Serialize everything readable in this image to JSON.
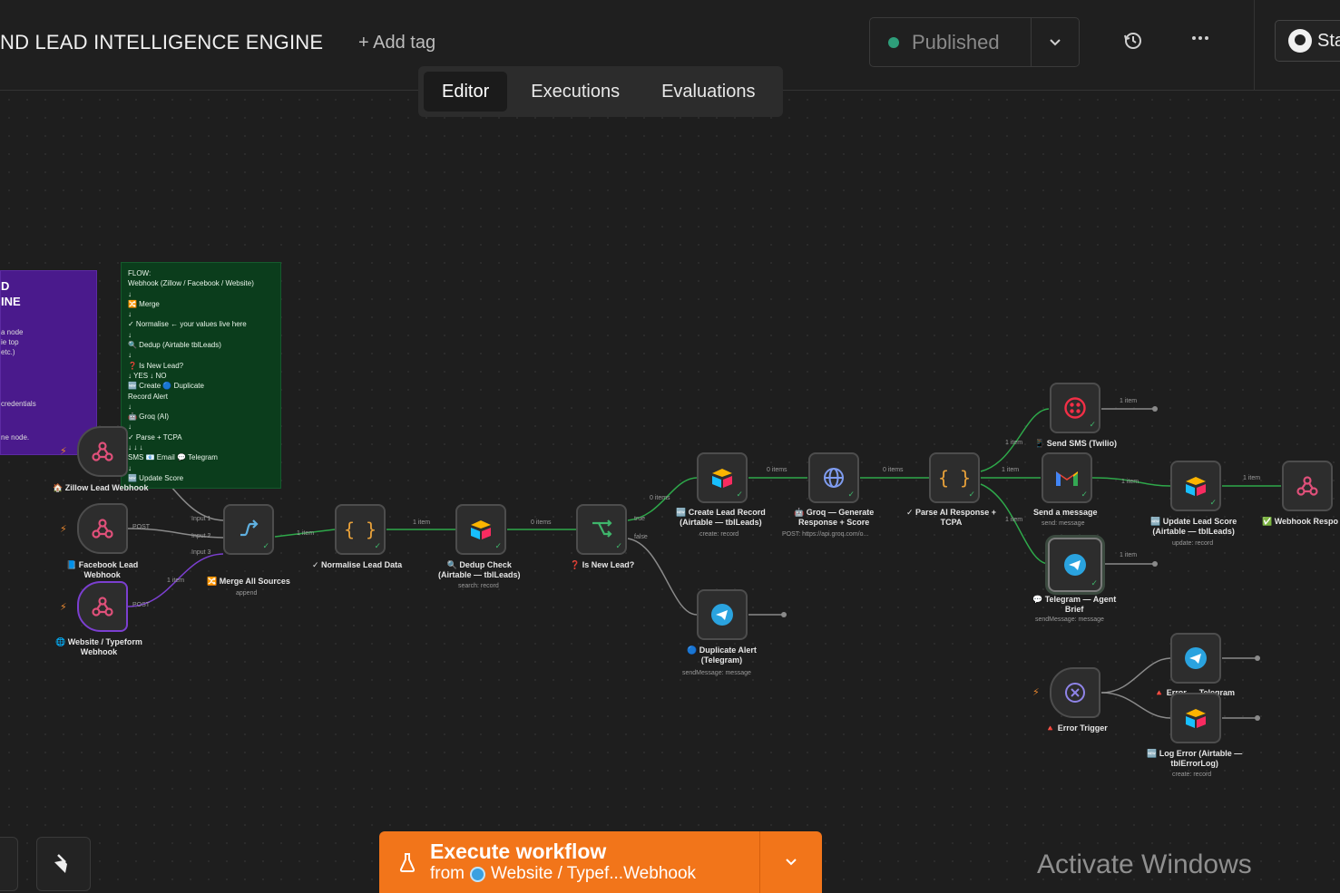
{
  "header": {
    "title": "ND LEAD INTELLIGENCE ENGINE",
    "add_tag": "+ Add tag",
    "publish_label": "Published",
    "github_label": "Sta"
  },
  "tabs": [
    {
      "label": "Editor",
      "active": true
    },
    {
      "label": "Executions",
      "active": false
    },
    {
      "label": "Evaluations",
      "active": false
    }
  ],
  "sticky_purple": {
    "lines_big": [
      "D",
      "INE"
    ],
    "lines_small": [
      "a node",
      "ie top",
      "etc.)",
      "",
      "",
      "credentials",
      "",
      "ne node."
    ]
  },
  "sticky_green": {
    "lines": [
      "FLOW:",
      "Webhook (Zillow / Facebook / Website)",
      "↓",
      "🔀 Merge",
      "↓",
      "✓ Normalise ← your values live here",
      "↓",
      "🔍 Dedup (Airtable tblLeads)",
      "↓",
      "❓ Is New Lead?",
      "↓ YES ↓ NO",
      "🆕 Create 🔵 Duplicate",
      "Record Alert",
      "↓",
      "🤖 Groq (AI)",
      "↓",
      "✓ Parse + TCPA",
      "↓ ↓ ↓",
      "SMS 📧 Email 💬 Telegram",
      "↓",
      "🆕 Update Score"
    ]
  },
  "nodes": {
    "zillow": {
      "label": "🏠 Zillow Lead Webhook"
    },
    "facebook": {
      "label1": "📘 Facebook Lead",
      "label2": "Webhook",
      "port": "POST"
    },
    "website": {
      "label1": "🌐 Website / Typeform",
      "label2": "Webhook",
      "port": "POST"
    },
    "merge": {
      "label": "🔀 Merge All Sources",
      "sub": "append",
      "in1": "Input 1",
      "in2": "Input 2",
      "in3": "Input 3"
    },
    "normalise": {
      "label": "✓ Normalise Lead Data"
    },
    "dedup": {
      "label1": "🔍 Dedup Check",
      "label2": "(Airtable — tblLeads)",
      "sub": "search: record"
    },
    "is_new": {
      "label": "❓ Is New Lead?",
      "out_true": "true",
      "out_false": "false"
    },
    "create_lead": {
      "label1": "🆕 Create Lead Record",
      "label2": "(Airtable — tblLeads)",
      "sub": "create: record"
    },
    "duplicate_alert": {
      "label1": "🔵 Duplicate Alert",
      "label2": "(Telegram)",
      "sub": "sendMessage: message"
    },
    "groq": {
      "label1": "🤖 Groq — Generate",
      "label2": "Response + Score",
      "sub": "POST: https://api.groq.com/o..."
    },
    "parse": {
      "label1": "✓ Parse AI Response +",
      "label2": "TCPA"
    },
    "send_sms": {
      "label": "📱 Send SMS (Twilio)"
    },
    "send_message": {
      "label": "Send a message",
      "sub": "send: message"
    },
    "telegram_agent": {
      "label1": "💬 Telegram — Agent",
      "label2": "Brief",
      "sub": "sendMessage: message"
    },
    "update_score": {
      "label1": "🆕 Update Lead Score",
      "label2": "(Airtable — tblLeads)",
      "sub": "update: record"
    },
    "webhook_response": {
      "label": "✅ Webhook Respo"
    },
    "error_trigger": {
      "label": "🔺 Error Trigger"
    },
    "error_telegram": {
      "label": "🔺 Error — Telegram"
    },
    "log_error": {
      "label1": "🆕 Log Error (Airtable —",
      "label2": "tblErrorLog)",
      "sub": "create: record"
    }
  },
  "connection_labels": {
    "zillow_merge": "1 item",
    "website_merge": "1 item",
    "merge_normalise": "1 item",
    "normalise_dedup": "1 item",
    "dedup_isnew": "0 items",
    "isnew_create": "0 items",
    "create_groq": "0 items",
    "groq_parse": "0 items",
    "parse_sms": "1 item",
    "parse_send": "1 item",
    "parse_telegram": "1 item",
    "sms_out": "1 item",
    "send_update": "1 item",
    "update_webhook": "1 item",
    "telegram_out": "1 item"
  },
  "footer": {
    "execute_line1": "Execute workflow",
    "execute_from": "from",
    "execute_line2": "Website / Typef...Webhook",
    "activate_windows": "Activate Windows"
  },
  "colors": {
    "accent_orange": "#f2751a",
    "published_dot": "#2e9e7a",
    "sticky_purple": "#4a1a8c",
    "sticky_green": "#0b3d1c",
    "wire": "#2ea84a",
    "webhook_icon": "#e0507a"
  },
  "icons": {
    "history": "history-icon",
    "more": "more-horizontal-icon",
    "caret": "chevron-down-icon",
    "flask": "flask-icon",
    "broom": "broom-icon",
    "github": "github-icon"
  }
}
